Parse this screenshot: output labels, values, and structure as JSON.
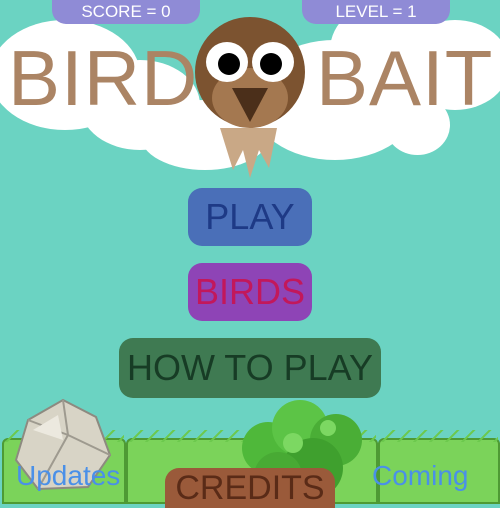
{
  "hud": {
    "score_text": "SCORE = 0",
    "level_text": "LEVEL = 1"
  },
  "title": {
    "word1": "BIRD",
    "word2": "BAIT"
  },
  "menu": {
    "play": "PLAY",
    "birds": "BIRDS",
    "how_to_play": "HOW TO PLAY"
  },
  "bottom": {
    "updates": "Updates",
    "credits": "CREDITS",
    "coming": "Coming"
  },
  "colors": {
    "sky": "#6bd3c2",
    "title": "#ab8464",
    "play_button": "#4a6fb8",
    "birds_button": "#8e44b6",
    "howto_button": "#3f7a52",
    "credits_button": "#9a5a3a",
    "bird_body": "#7c5330"
  },
  "icons": {
    "bird": "bird-mascot-icon",
    "rock": "rock-icon",
    "bush": "bush-icon"
  }
}
